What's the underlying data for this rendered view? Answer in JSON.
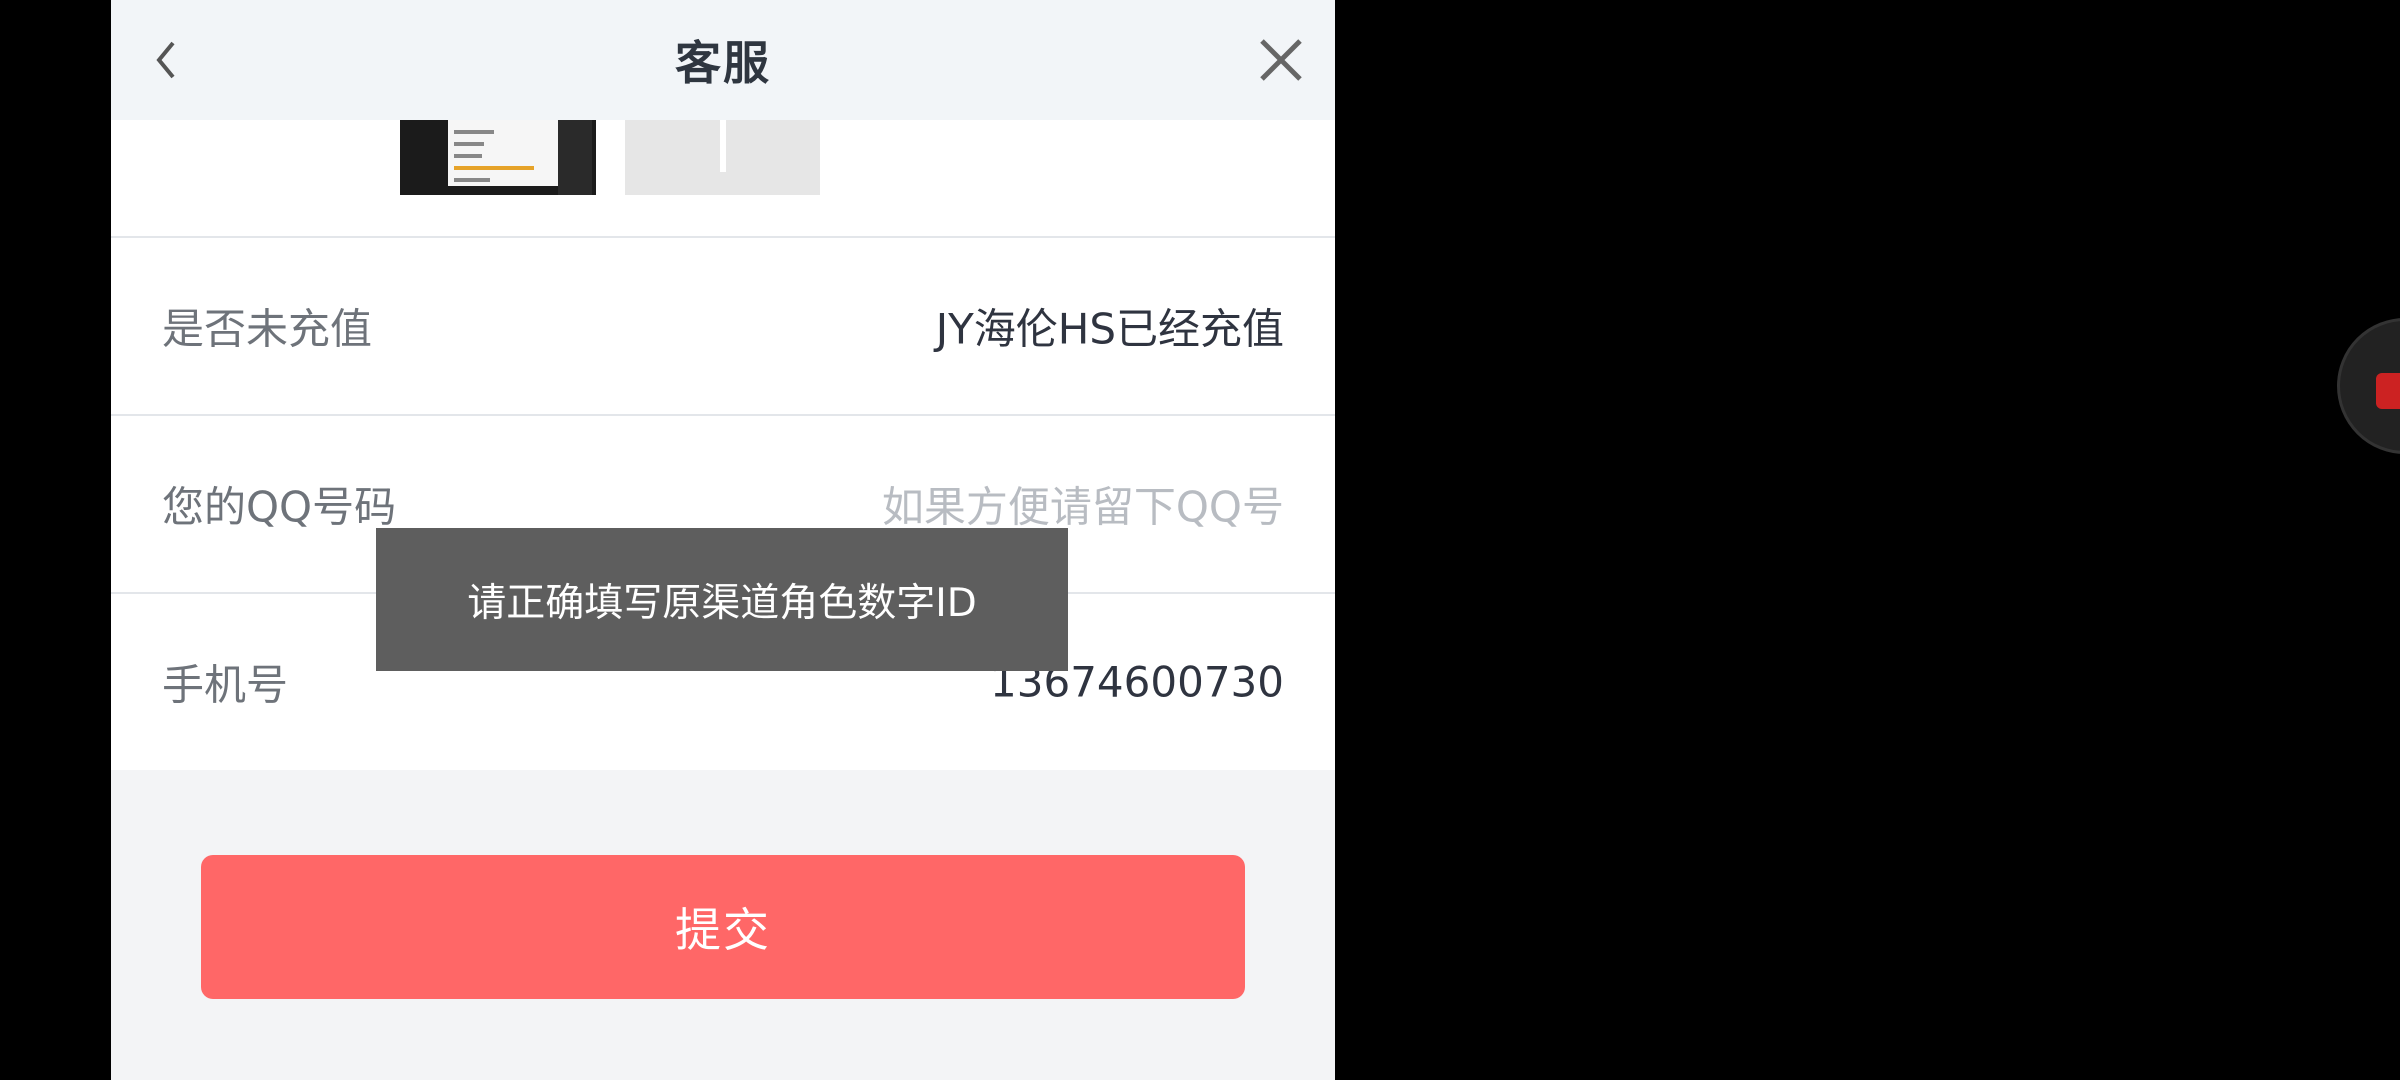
{
  "header": {
    "title": "客服",
    "back_icon": "chevron-left-icon",
    "close_icon": "close-icon"
  },
  "form": {
    "recharge": {
      "label": "是否未充值",
      "value": "JY海伦HS已经充值"
    },
    "qq": {
      "label": "您的QQ号码",
      "placeholder": "如果方便请留下QQ号",
      "value": ""
    },
    "phone": {
      "label": "手机号",
      "value": "13674600730"
    }
  },
  "submit": {
    "label": "提交"
  },
  "toast": {
    "text": "请正确填写原渠道角色数字ID"
  },
  "colors": {
    "accent": "#ff6767",
    "header_bg": "#f2f5f8",
    "toast_bg": "#5e5e5e"
  }
}
